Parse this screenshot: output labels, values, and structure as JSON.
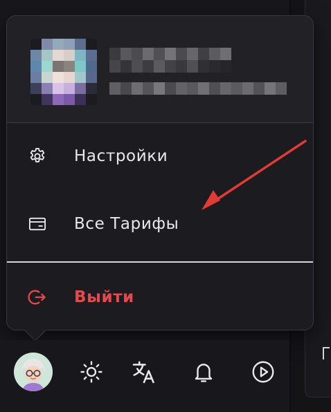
{
  "menu": {
    "items": [
      {
        "label": "Настройки",
        "icon": "gear-icon"
      },
      {
        "label": "Все Тарифы",
        "icon": "wallet-card-icon"
      }
    ],
    "logout": {
      "label": "Выйти",
      "icon": "logout-icon"
    }
  },
  "colors": {
    "menu_bg": "#1c1c20",
    "header_bg": "#222226",
    "text": "#e9e9eb",
    "danger": "#e5484d",
    "annotation_arrow": "#e23b36"
  },
  "toolbar": {
    "buttons": [
      {
        "icon": "user-avatar-icon"
      },
      {
        "icon": "sun-icon"
      },
      {
        "icon": "translate-icon"
      },
      {
        "icon": "bell-icon"
      },
      {
        "icon": "play-circle-icon"
      }
    ]
  }
}
